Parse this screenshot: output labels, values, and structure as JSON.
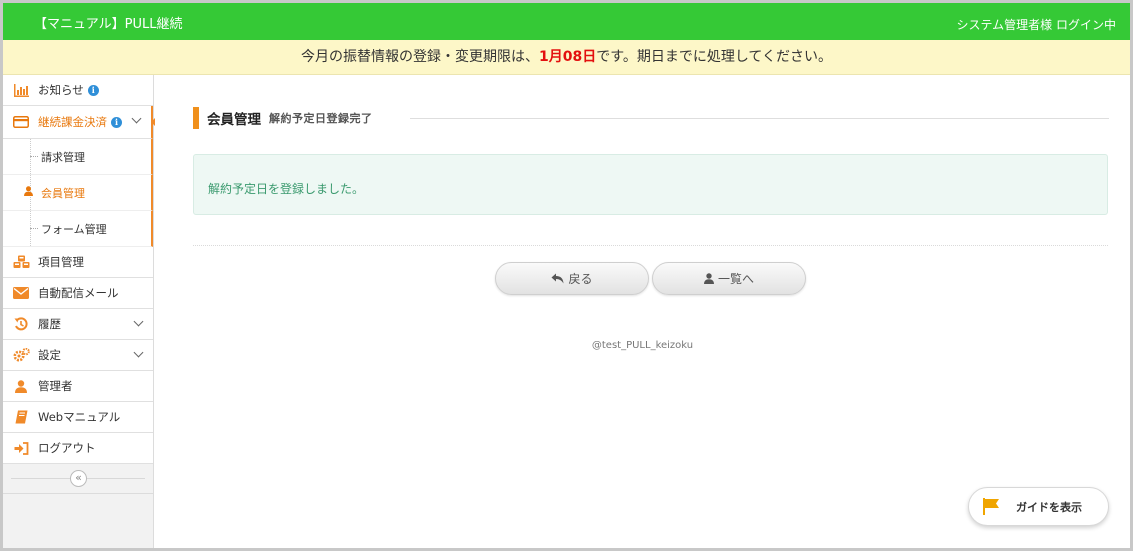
{
  "header": {
    "app_title": "【マニュアル】PULL継続",
    "login_status": "システム管理者様 ログイン中"
  },
  "notice": {
    "prefix": "今月の振替情報の登録・変更期限は、",
    "deadline": "1月08日",
    "suffix": "です。期日までに処理してください。"
  },
  "sidebar": {
    "items": [
      {
        "label": "お知らせ",
        "icon": "bar-chart-icon",
        "badge": "i"
      },
      {
        "label": "継続課金決済",
        "icon": "credit-card-icon",
        "badge": "i"
      },
      {
        "label": "項目管理",
        "icon": "cubes-icon"
      },
      {
        "label": "自動配信メール",
        "icon": "envelope-icon"
      },
      {
        "label": "履歴",
        "icon": "history-icon"
      },
      {
        "label": "設定",
        "icon": "gears-icon"
      },
      {
        "label": "管理者",
        "icon": "user-icon"
      },
      {
        "label": "Webマニュアル",
        "icon": "book-icon"
      },
      {
        "label": "ログアウト",
        "icon": "sign-out-icon"
      }
    ],
    "subitems": [
      {
        "label": "請求管理"
      },
      {
        "label": "会員管理"
      },
      {
        "label": "フォーム管理"
      }
    ],
    "collapse_symbol": "«"
  },
  "main": {
    "title": "会員管理",
    "subtitle": "解約予定日登録完了",
    "message": "解約予定日を登録しました。",
    "back_button": "戻る",
    "list_button": "一覧へ",
    "account_id": "@test_PULL_keizoku"
  },
  "guide": {
    "label": "ガイドを表示"
  },
  "colors": {
    "header_green": "#35c936",
    "accent_orange": "#f0901c",
    "deadline_red": "#e3100f",
    "success_green": "#3a9a6e",
    "info_blue": "#2f8fd8"
  }
}
